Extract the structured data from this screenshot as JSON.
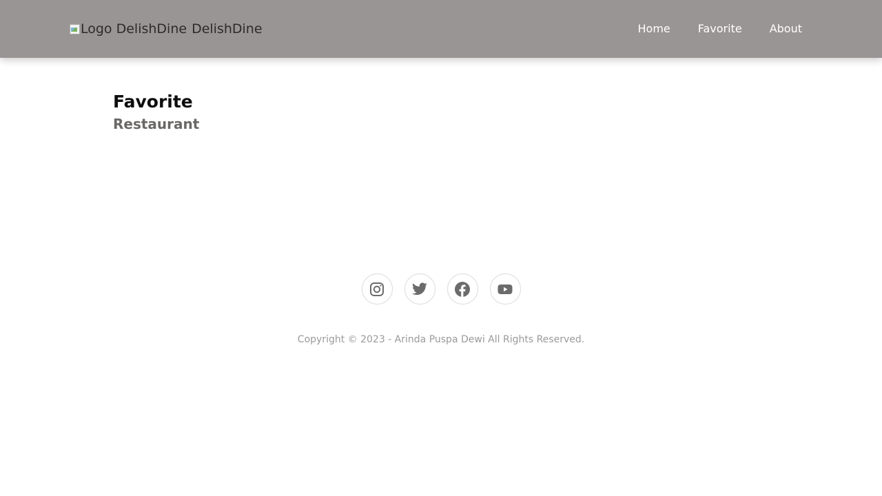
{
  "header": {
    "logo_alt": "Logo DelishDine",
    "brand_name": "DelishDine",
    "nav": [
      {
        "label": "Home"
      },
      {
        "label": "Favorite"
      },
      {
        "label": "About"
      }
    ]
  },
  "main": {
    "title": "Favorite",
    "subtitle": "Restaurant"
  },
  "footer": {
    "social": [
      {
        "name": "instagram-icon"
      },
      {
        "name": "twitter-icon"
      },
      {
        "name": "facebook-icon"
      },
      {
        "name": "youtube-icon"
      }
    ],
    "copyright": "Copyright © 2023 - Arinda Puspa Dewi All Rights Reserved."
  },
  "colors": {
    "header_bg": "#999594",
    "nav_text": "#ffffff",
    "subtitle": "#6a6866",
    "icon": "#6b6b6b",
    "footer_text": "#9a9a9a"
  }
}
